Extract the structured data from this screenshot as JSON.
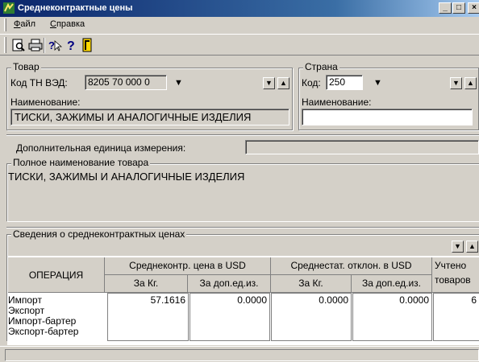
{
  "window": {
    "title": "Среднеконтрактные цены",
    "buttons": {
      "minimize": "_",
      "maximize": "□",
      "close": "×"
    }
  },
  "menu": {
    "items": [
      {
        "label": "Файл",
        "accel": "Ф",
        "rest": "айл"
      },
      {
        "label": "Справка",
        "accel": "С",
        "rest": "правка"
      }
    ]
  },
  "toolbar": {
    "icons": [
      "print-preview-icon",
      "printer-icon",
      "context-help-icon",
      "help-icon",
      "exit-icon"
    ],
    "help_label": "?"
  },
  "product": {
    "group_title": "Товар",
    "code_label": "Код ТН ВЭД:",
    "code_value": "8205 70 000 0",
    "name_label": "Наименование:",
    "name_value": "ТИСКИ, ЗАЖИМЫ И АНАЛОГИЧНЫЕ ИЗДЕЛИЯ"
  },
  "country": {
    "group_title": "Страна",
    "code_label": "Код:",
    "code_value": "250",
    "name_label": "Наименование:",
    "name_value": ""
  },
  "nav_buttons": {
    "down": "▼",
    "up": "▲"
  },
  "dropdown_arrow": "▼",
  "extra_unit": {
    "label": "Дополнительная единица измерения:",
    "value": ""
  },
  "full_name": {
    "group_title": "Полное наименование товара",
    "value": "ТИСКИ, ЗАЖИМЫ И АНАЛОГИЧНЫЕ ИЗДЕЛИЯ"
  },
  "prices": {
    "group_title": "Сведения о среднеконтрактных ценах",
    "headers": {
      "operation": "ОПЕРАЦИЯ",
      "avg_price": "Среднеконтр. цена в USD",
      "avg_dev": "Среднестат. отклон. в USD",
      "counted": "Учтено",
      "counted2": "товаров",
      "per_kg": "За Кг.",
      "per_extra": "За доп.ед.из.",
      "per_kg2": "За Кг.",
      "per_extra2": "За доп.ед.из."
    },
    "operations": [
      "Импорт",
      "Экспорт",
      "Импорт-бартер",
      "Экспорт-бартер"
    ],
    "values": {
      "price_kg": "57.1616",
      "price_extra": "0.0000",
      "dev_kg": "0.0000",
      "dev_extra": "0.0000",
      "counted": "6"
    }
  },
  "colors": {
    "titlebar": "#0a246a",
    "face": "#d4d0c8",
    "field_white": "#ffffff"
  }
}
